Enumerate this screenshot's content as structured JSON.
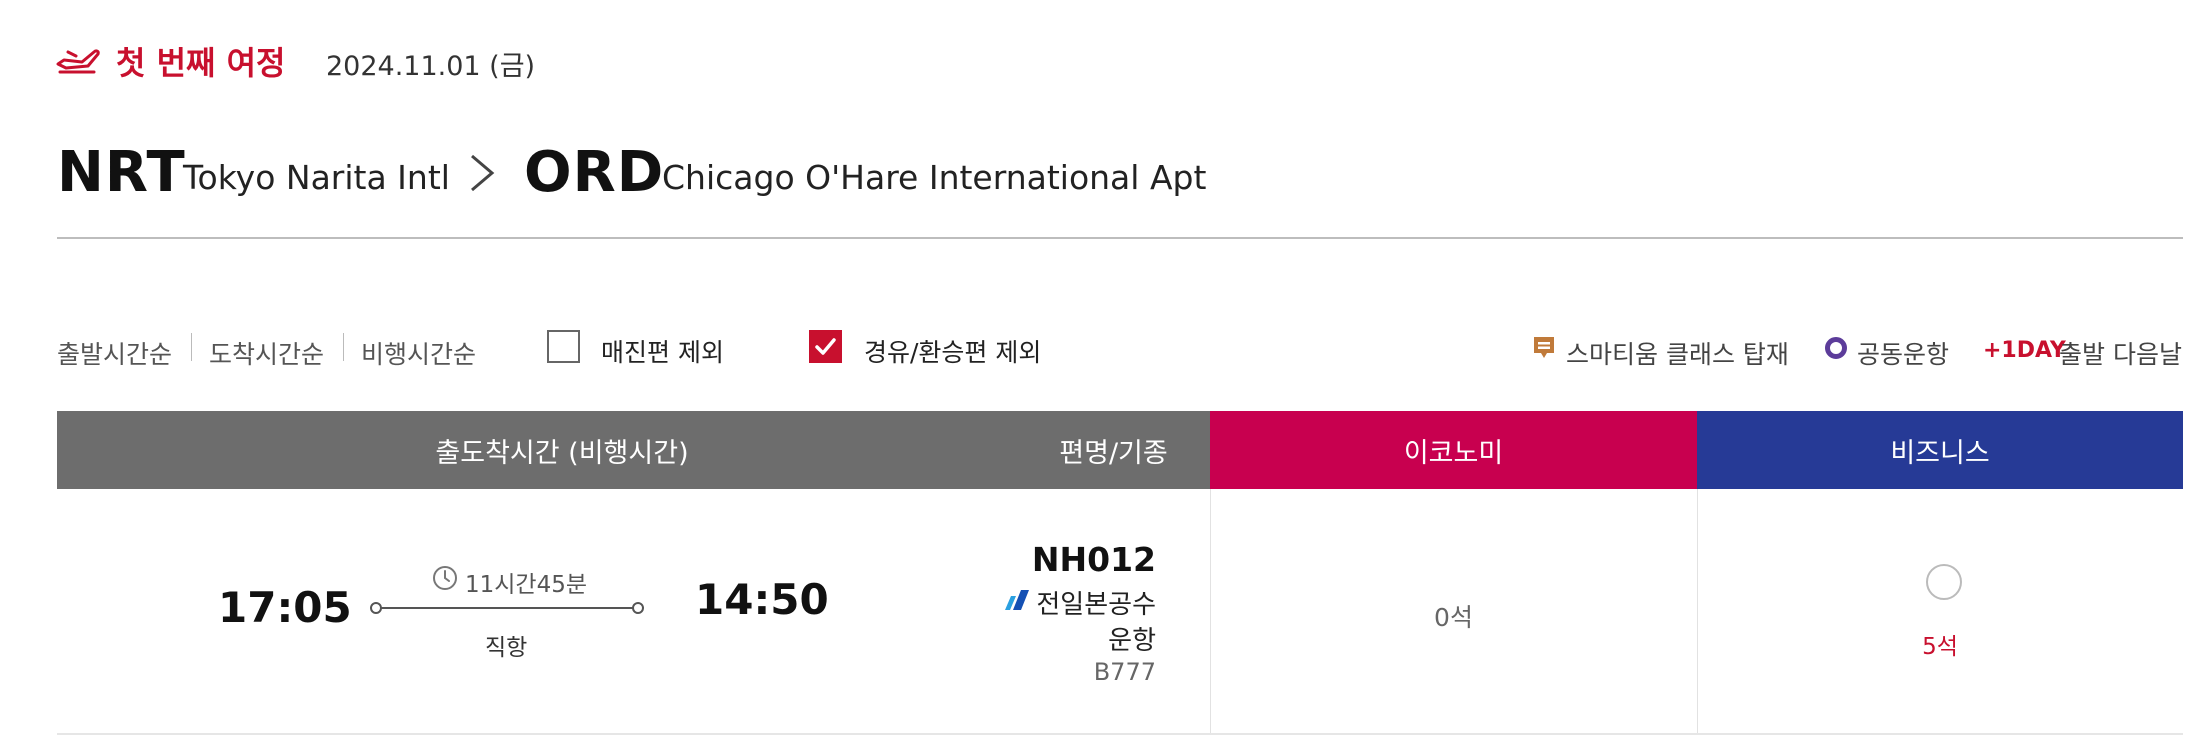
{
  "journey": {
    "title": "첫 번째 여정",
    "date": "2024.11.01 (금)"
  },
  "route": {
    "departure_code": "NRT",
    "departure_name": "Tokyo Narita Intl",
    "arrival_code": "ORD",
    "arrival_name": "Chicago O'Hare International Apt"
  },
  "sort": {
    "departure": "출발시간순",
    "arrival": "도착시간순",
    "duration": "비행시간순"
  },
  "filters": {
    "exclude_soldout": {
      "label": "매진편 제외",
      "checked": false
    },
    "exclude_transit": {
      "label": "경유/환승편 제외",
      "checked": true
    }
  },
  "legend": {
    "smartium": "스마티움 클래스 탑재",
    "codeshare": "공동운항",
    "plus1_badge": "+1DAY",
    "plus1_text": "출발 다음날"
  },
  "table": {
    "headers": {
      "time": "출도착시간 (비행시간)",
      "flight": "편명/기종",
      "economy": "이코노미",
      "business": "비즈니스"
    },
    "rows": [
      {
        "dep_time": "17:05",
        "arr_time": "14:50",
        "duration": "11시간45분",
        "stops": "직항",
        "flight_no": "NH012",
        "operator_line1": "전일본공수",
        "operator_line2": "운항",
        "aircraft": "B777",
        "economy_seats": "0석",
        "business_seats": "5석"
      }
    ]
  },
  "colors": {
    "brand_red": "#c8102e",
    "economy": "#c8004f",
    "business": "#263a96",
    "header_gray": "#6d6d6d",
    "codeshare": "#5c3c9a"
  },
  "icons": [
    "plane-departure-icon",
    "chevron-right-icon",
    "checkbox-icon",
    "check-icon",
    "smartium-icon",
    "codeshare-icon",
    "clock-icon",
    "ana-logo-icon",
    "radio-icon"
  ]
}
